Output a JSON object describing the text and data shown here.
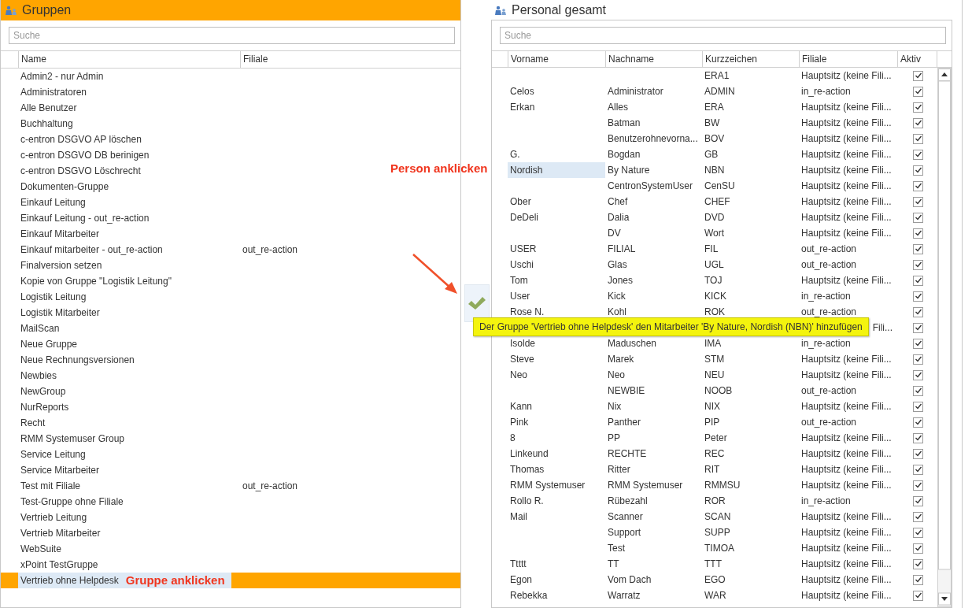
{
  "groups": {
    "title": "Gruppen",
    "search": {
      "placeholder": "Suche"
    },
    "columns": [
      "Name",
      "Filiale"
    ],
    "rows": [
      {
        "name": "Admin2 - nur Admin",
        "selected": false
      },
      {
        "name": "Administratoren",
        "selected": false
      },
      {
        "name": "Alle Benutzer",
        "selected": false
      },
      {
        "name": "Buchhaltung",
        "selected": false
      },
      {
        "name": "c-entron DSGVO AP löschen",
        "selected": false
      },
      {
        "name": "c-entron DSGVO DB berinigen",
        "selected": false
      },
      {
        "name": "c-entron DSGVO Löschrecht",
        "selected": false
      },
      {
        "name": "Dokumenten-Gruppe",
        "selected": false
      },
      {
        "name": "Einkauf Leitung",
        "selected": false
      },
      {
        "name": "Einkauf Leitung - out_re-action",
        "selected": false
      },
      {
        "name": "Einkauf Mitarbeiter",
        "selected": false
      },
      {
        "name": "Einkauf mitarbeiter - out_re-action",
        "filiale": "out_re-action",
        "selected": false
      },
      {
        "name": "Finalversion setzen",
        "selected": false
      },
      {
        "name": "Kopie von Gruppe \"Logistik Leitung\"",
        "selected": false
      },
      {
        "name": "Logistik Leitung",
        "selected": false
      },
      {
        "name": "Logistik Mitarbeiter",
        "selected": false
      },
      {
        "name": "MailScan",
        "selected": false
      },
      {
        "name": "Neue Gruppe",
        "selected": false
      },
      {
        "name": "Neue Rechnungsversionen",
        "selected": false
      },
      {
        "name": "Newbies",
        "selected": false
      },
      {
        "name": "NewGroup",
        "selected": false
      },
      {
        "name": "NurReports",
        "selected": false
      },
      {
        "name": "Recht",
        "selected": false
      },
      {
        "name": "RMM Systemuser Group",
        "selected": false
      },
      {
        "name": "Service Leitung",
        "selected": false
      },
      {
        "name": "Service Mitarbeiter",
        "selected": false
      },
      {
        "name": "Test mit Filiale",
        "filiale": "out_re-action",
        "selected": false
      },
      {
        "name": "Test-Gruppe ohne Filiale",
        "selected": false
      },
      {
        "name": "Vertrieb Leitung",
        "selected": false
      },
      {
        "name": "Vertrieb Mitarbeiter",
        "selected": false
      },
      {
        "name": "WebSuite",
        "selected": false
      },
      {
        "name": "xPoint TestGruppe",
        "selected": false
      },
      {
        "name": "Vertrieb ohne Helpdesk",
        "selected": true
      }
    ],
    "annotation": "Gruppe anklicken"
  },
  "personal": {
    "title": "Personal gesamt",
    "search": {
      "placeholder": "Suche"
    },
    "columns": [
      "Vorname",
      "Nachname",
      "Kurzzeichen",
      "Filiale",
      "Aktiv"
    ],
    "annotation": "Person anklicken",
    "rows": [
      {
        "kurz": "ERA1",
        "filiale": "Hauptsitz (keine Fili...",
        "aktiv": true,
        "selected": false
      },
      {
        "vorname": "Celos",
        "nachname": "Administrator",
        "kurz": "ADMIN",
        "filiale": "in_re-action",
        "aktiv": true,
        "selected": false
      },
      {
        "vorname": "Erkan",
        "nachname": "Alles",
        "kurz": "ERA",
        "filiale": "Hauptsitz (keine Fili...",
        "aktiv": true,
        "selected": false
      },
      {
        "nachname": "Batman",
        "kurz": "BW",
        "filiale": "Hauptsitz (keine Fili...",
        "aktiv": true,
        "selected": false
      },
      {
        "nachname": "Benutzerohnevorna...",
        "kurz": "BOV",
        "filiale": "Hauptsitz (keine Fili...",
        "aktiv": true,
        "selected": false
      },
      {
        "vorname": "G.",
        "nachname": "Bogdan",
        "kurz": "GB",
        "filiale": "Hauptsitz (keine Fili...",
        "aktiv": true,
        "selected": false
      },
      {
        "vorname": "Nordish",
        "nachname": "By Nature",
        "kurz": "NBN",
        "filiale": "Hauptsitz (keine Fili...",
        "aktiv": true,
        "selected": true
      },
      {
        "nachname": "CentronSystemUser",
        "kurz": "CenSU",
        "filiale": "Hauptsitz (keine Fili...",
        "aktiv": true,
        "selected": false
      },
      {
        "vorname": "Ober",
        "nachname": "Chef",
        "kurz": "CHEF",
        "filiale": "Hauptsitz (keine Fili...",
        "aktiv": true,
        "selected": false
      },
      {
        "vorname": "DeDeli",
        "nachname": "Dalia",
        "kurz": "DVD",
        "filiale": "Hauptsitz (keine Fili...",
        "aktiv": true,
        "selected": false
      },
      {
        "nachname": "DV",
        "kurz": "Wort",
        "filiale": "Hauptsitz (keine Fili...",
        "aktiv": true,
        "selected": false
      },
      {
        "vorname": "USER",
        "nachname": "FILIAL",
        "kurz": "FIL",
        "filiale": "out_re-action",
        "aktiv": true,
        "selected": false
      },
      {
        "vorname": "Uschi",
        "nachname": "Glas",
        "kurz": "UGL",
        "filiale": "out_re-action",
        "aktiv": true,
        "selected": false
      },
      {
        "vorname": "Tom",
        "nachname": "Jones",
        "kurz": "TOJ",
        "filiale": "Hauptsitz (keine Fili...",
        "aktiv": true,
        "selected": false
      },
      {
        "vorname": "User",
        "nachname": "Kick",
        "kurz": "KICK",
        "filiale": "in_re-action",
        "aktiv": true,
        "selected": false
      },
      {
        "vorname": "Rose N.",
        "nachname": "Kohl",
        "kurz": "ROK",
        "filiale": "out_re-action",
        "aktiv": true,
        "selected": false
      },
      {
        "filiale_tail": "Fili...",
        "aktiv": true
      },
      {
        "vorname": "Isolde",
        "nachname": "Maduschen",
        "kurz": "IMA",
        "filiale": "in_re-action",
        "aktiv": true,
        "selected": false
      },
      {
        "vorname": "Steve",
        "nachname": "Marek",
        "kurz": "STM",
        "filiale": "Hauptsitz (keine Fili...",
        "aktiv": true,
        "selected": false
      },
      {
        "vorname": "Neo",
        "nachname": "Neo",
        "kurz": "NEU",
        "filiale": "Hauptsitz (keine Fili...",
        "aktiv": true,
        "selected": false
      },
      {
        "nachname": "NEWBIE",
        "kurz": "NOOB",
        "filiale": "out_re-action",
        "aktiv": true,
        "selected": false
      },
      {
        "vorname": "Kann",
        "nachname": "Nix",
        "kurz": "NIX",
        "filiale": "Hauptsitz (keine Fili...",
        "aktiv": true,
        "selected": false
      },
      {
        "vorname": "Pink",
        "nachname": "Panther",
        "kurz": "PIP",
        "filiale": "out_re-action",
        "aktiv": true,
        "selected": false
      },
      {
        "vorname": "8",
        "nachname": "PP",
        "kurz": "Peter",
        "filiale": "Hauptsitz (keine Fili...",
        "aktiv": true,
        "selected": false
      },
      {
        "vorname": "Linkeund",
        "nachname": "RECHTE",
        "kurz": "REC",
        "filiale": "Hauptsitz (keine Fili...",
        "aktiv": true,
        "selected": false
      },
      {
        "vorname": "Thomas",
        "nachname": "Ritter",
        "kurz": "RIT",
        "filiale": "Hauptsitz (keine Fili...",
        "aktiv": true,
        "selected": false
      },
      {
        "vorname": "RMM Systemuser",
        "nachname": "RMM Systemuser",
        "kurz": "RMMSU",
        "filiale": "Hauptsitz (keine Fili...",
        "aktiv": true,
        "selected": false
      },
      {
        "vorname": "Rollo R.",
        "nachname": "Rübezahl",
        "kurz": "ROR",
        "filiale": "in_re-action",
        "aktiv": true,
        "selected": false
      },
      {
        "vorname": "Mail",
        "nachname": "Scanner",
        "kurz": "SCAN",
        "filiale": "Hauptsitz (keine Fili...",
        "aktiv": true,
        "selected": false
      },
      {
        "nachname": "Support",
        "kurz": "SUPP",
        "filiale": "Hauptsitz (keine Fili...",
        "aktiv": true,
        "selected": false
      },
      {
        "nachname": "Test",
        "kurz": "TIMOA",
        "filiale": "Hauptsitz (keine Fili...",
        "aktiv": true,
        "selected": false
      },
      {
        "vorname": "Ttttt",
        "nachname": "TT",
        "kurz": "TTT",
        "filiale": "Hauptsitz (keine Fili...",
        "aktiv": true,
        "selected": false
      },
      {
        "vorname": "Egon",
        "nachname": "Vom Dach",
        "kurz": "EGO",
        "filiale": "Hauptsitz (keine Fili...",
        "aktiv": true,
        "selected": false
      },
      {
        "vorname": "Rebekka",
        "nachname": "Warratz",
        "kurz": "WAR",
        "filiale": "Hauptsitz (keine Fili...",
        "aktiv": true,
        "selected": false
      }
    ]
  },
  "tooltip": "Der Gruppe 'Vertrieb ohne Helpdesk' den Mitarbeiter 'By Nature, Nordish (NBN)' hinzufügen"
}
